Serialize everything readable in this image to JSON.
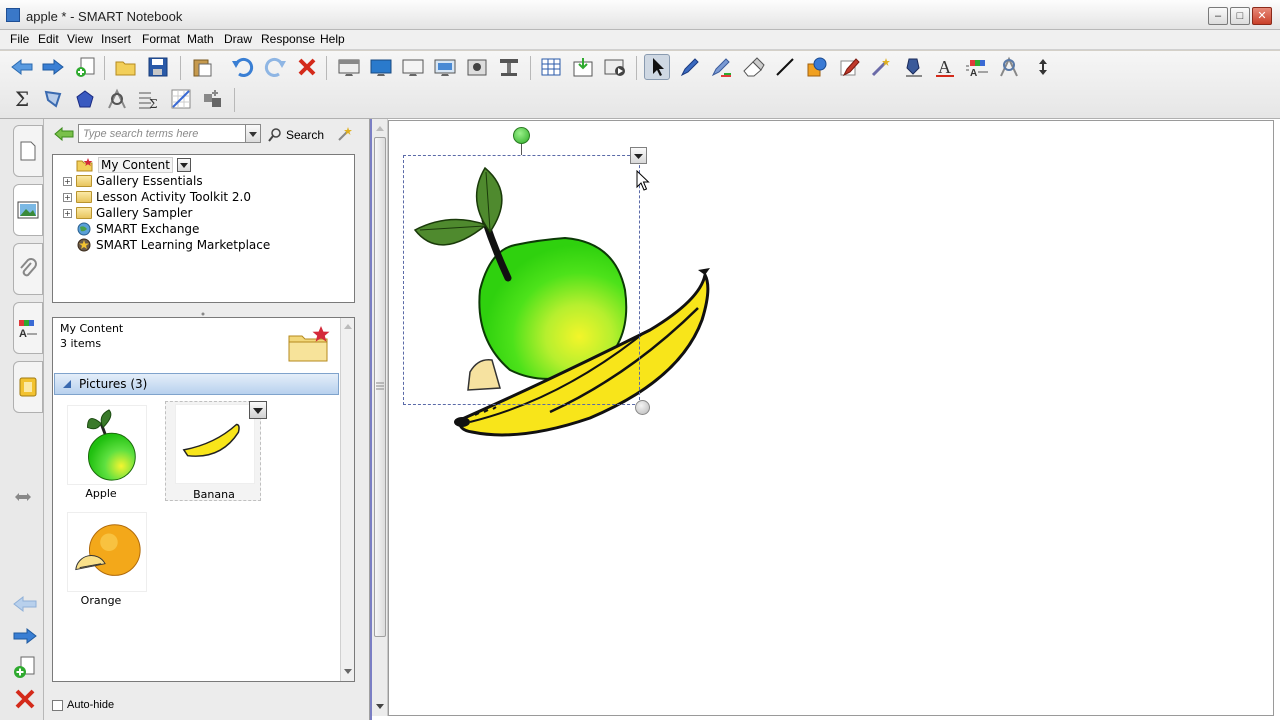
{
  "window": {
    "title": "apple * - SMART Notebook",
    "buttons": [
      "minimize",
      "maximize",
      "close"
    ]
  },
  "menu": [
    "File",
    "Edit",
    "View",
    "Insert",
    "Format",
    "Math",
    "Draw",
    "Response",
    "Help"
  ],
  "toolbar": {
    "row1": [
      "back-arrow-icon",
      "forward-arrow-icon",
      "add-page-icon",
      "open-folder-icon",
      "save-icon",
      "paste-icon",
      "undo-icon",
      "redo-icon",
      "delete-icon",
      "screen-shade-icon",
      "full-screen-icon",
      "transparent-bg-icon",
      "dual-display-icon",
      "capture-icon",
      "document-camera-icon",
      "table-icon",
      "attach-icon",
      "recorder-icon",
      "select-icon",
      "pen-icon",
      "creative-pen-icon",
      "eraser-icon",
      "line-icon",
      "shapes-icon",
      "magic-pen-icon",
      "fill-icon",
      "text-icon",
      "properties-icon",
      "geometry-icon",
      "move-toolbar-icon"
    ],
    "row2": [
      "sum-icon",
      "polygon-icon",
      "pentagon-icon",
      "geometry-tool-icon",
      "formula-icon",
      "graph-icon",
      "addon-icon"
    ],
    "active": "select-icon"
  },
  "side_tabs": [
    "page-sorter-icon",
    "gallery-icon",
    "attachments-icon",
    "properties-icon",
    "addons-icon"
  ],
  "gallery": {
    "search": {
      "placeholder": "Type search terms here",
      "button": "Search"
    },
    "tree": [
      {
        "label": "My Content",
        "expandable": false,
        "selected": true,
        "icon": "star-folder-icon"
      },
      {
        "label": "Gallery Essentials",
        "expandable": true,
        "icon": "folder-icon"
      },
      {
        "label": "Lesson Activity Toolkit 2.0",
        "expandable": true,
        "icon": "folder-icon"
      },
      {
        "label": "Gallery Sampler",
        "expandable": true,
        "icon": "folder-icon"
      },
      {
        "label": "SMART Exchange",
        "expandable": false,
        "icon": "globe-icon"
      },
      {
        "label": "SMART Learning Marketplace",
        "expandable": false,
        "icon": "marketplace-icon"
      }
    ],
    "contents": {
      "title": "My Content",
      "count": "3 items",
      "section": "Pictures (3)",
      "items": [
        {
          "caption": "Apple"
        },
        {
          "caption": "Banana"
        },
        {
          "caption": "Orange"
        }
      ]
    },
    "autohide": "Auto-hide"
  },
  "colors": {
    "apple_green": "#2fd10e",
    "banana_yellow": "#f8e51a",
    "orange": "#f3a81a",
    "selection_border": "#5a6aa8"
  }
}
